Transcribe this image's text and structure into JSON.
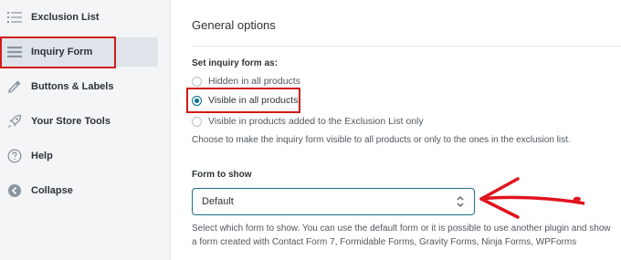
{
  "sidebar": {
    "items": [
      {
        "label": "Exclusion List",
        "icon": "list-icon"
      },
      {
        "label": "Inquiry Form",
        "icon": "form-icon",
        "active": true
      },
      {
        "label": "Buttons & Labels",
        "icon": "eyedropper-icon"
      },
      {
        "label": "Your Store Tools",
        "icon": "rocket-icon"
      },
      {
        "label": "Help",
        "icon": "question-icon"
      },
      {
        "label": "Collapse",
        "icon": "collapse-icon"
      }
    ]
  },
  "main": {
    "heading": "General options",
    "inquiry_section": {
      "label": "Set inquiry form as:",
      "options": [
        {
          "label": "Hidden in all products",
          "checked": false
        },
        {
          "label": "Visible in all products",
          "checked": true
        },
        {
          "label": "Visible in products added to the Exclusion List only",
          "checked": false
        }
      ],
      "help": "Choose to make the inquiry form visible to all products or only to the ones in the exclusion list."
    },
    "form_section": {
      "label": "Form to show",
      "select_value": "Default",
      "help_line1": "Select which form to show. You can use the default form or it is possible to use another plugin and show",
      "help_line2": "a form created with Contact Form 7, Formidable Forms, Gravity Forms, Ninja Forms, WPForms"
    }
  },
  "colors": {
    "accent": "#006c8e",
    "highlight": "#d11a1a",
    "sidebar_bg": "#f3f5f7"
  }
}
